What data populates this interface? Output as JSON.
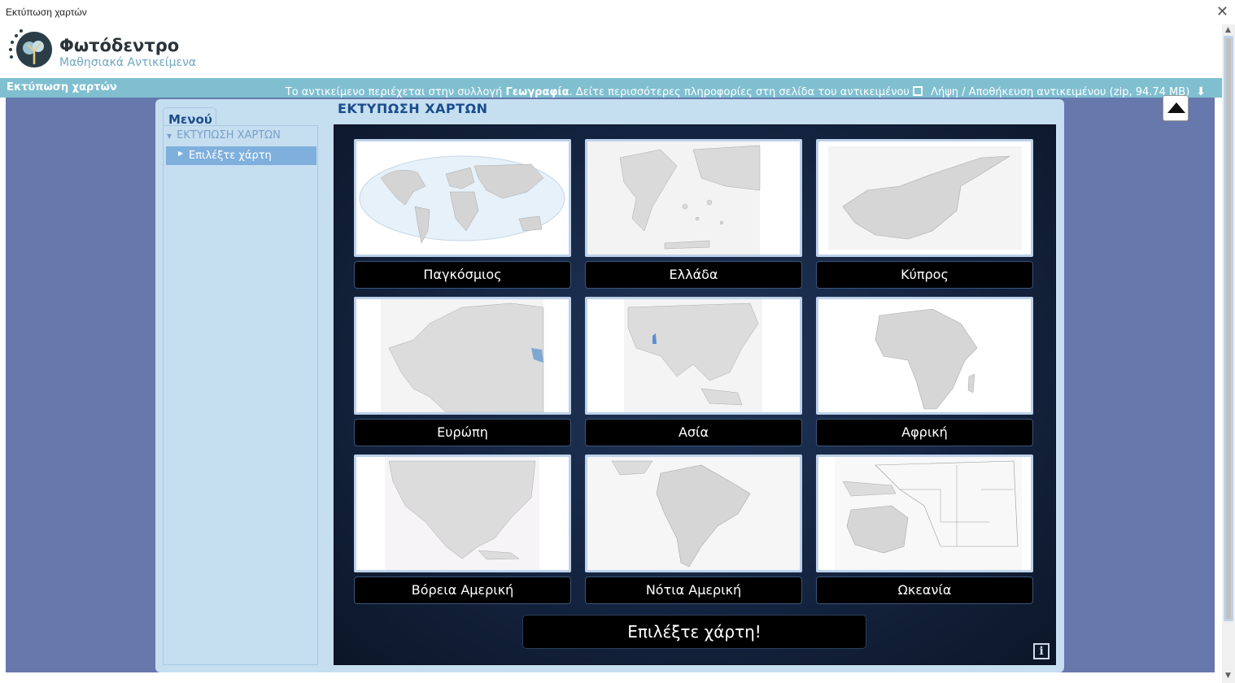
{
  "window": {
    "title": "Εκτύπωση χαρτών",
    "close_icon": "close-icon"
  },
  "brand": {
    "name": "Φωτόδεντρο",
    "subtitle": "Μαθησιακά Αντικείμενα"
  },
  "infobar": {
    "left_title": "Εκτύπωση χαρτών",
    "text_before": "Το αντικείμενο περιέχεται στην συλλογή ",
    "collection": "Γεωγραφία",
    "text_after": ". Δείτε περισσότερες πληροφορίες στη σελίδα του αντικειμένου",
    "download_label": "Λήψη / Αποθήκευση αντικειμένου (zip, 94.74 MB)"
  },
  "menu": {
    "tab_label": "Μενού",
    "section": "ΕΚΤΥΠΩΣΗ ΧΑΡΤΩΝ",
    "items": [
      {
        "label": "Επιλέξτε χάρτη"
      }
    ]
  },
  "main": {
    "title": "ΕΚΤΥΠΩΣΗ ΧΑΡΤΩΝ",
    "maps": [
      {
        "label": "Παγκόσμιος"
      },
      {
        "label": "Ελλάδα"
      },
      {
        "label": "Κύπρος"
      },
      {
        "label": "Ευρώπη"
      },
      {
        "label": "Ασία"
      },
      {
        "label": "Αφρική"
      },
      {
        "label": "Βόρεια Αμερική"
      },
      {
        "label": "Νότια Αμερική"
      },
      {
        "label": "Ωκεανία"
      }
    ],
    "choose_button": "Επιλέξτε χάρτη!",
    "info_button": "i"
  },
  "colors": {
    "accent": "#1a4d8c",
    "infobar": "#7fbfd0",
    "stage": "#6678ac",
    "panel": "#c5def0",
    "board": "#142440"
  }
}
